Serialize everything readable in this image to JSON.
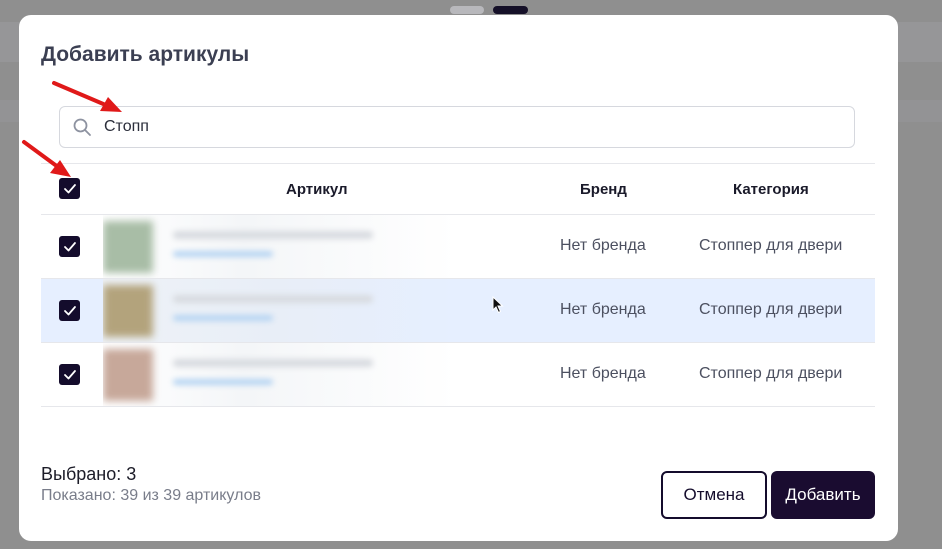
{
  "modal": {
    "title": "Добавить артикулы"
  },
  "search": {
    "value": "Стопп"
  },
  "table": {
    "columns": {
      "article": "Артикул",
      "brand": "Бренд",
      "category": "Категория"
    },
    "rows": [
      {
        "brand": "Нет бренда",
        "category": "Стоппер для двери",
        "checked": true,
        "highlighted": false
      },
      {
        "brand": "Нет бренда",
        "category": "Стоппер для двери",
        "checked": true,
        "highlighted": true
      },
      {
        "brand": "Нет бренда",
        "category": "Стоппер для двери",
        "checked": true,
        "highlighted": false
      }
    ]
  },
  "footer": {
    "selected": "Выбрано: 3",
    "shown": "Показано: 39 из 39 артикулов",
    "cancel_label": "Отмена",
    "add_label": "Добавить"
  },
  "colors": {
    "accent": "#140c2c",
    "row_highlight": "#e6efff",
    "annotation_arrow": "#e01919"
  },
  "icons": {
    "search": "search-icon",
    "check": "check-icon",
    "annotation": "red-arrow",
    "cursor": "mouse-cursor"
  }
}
